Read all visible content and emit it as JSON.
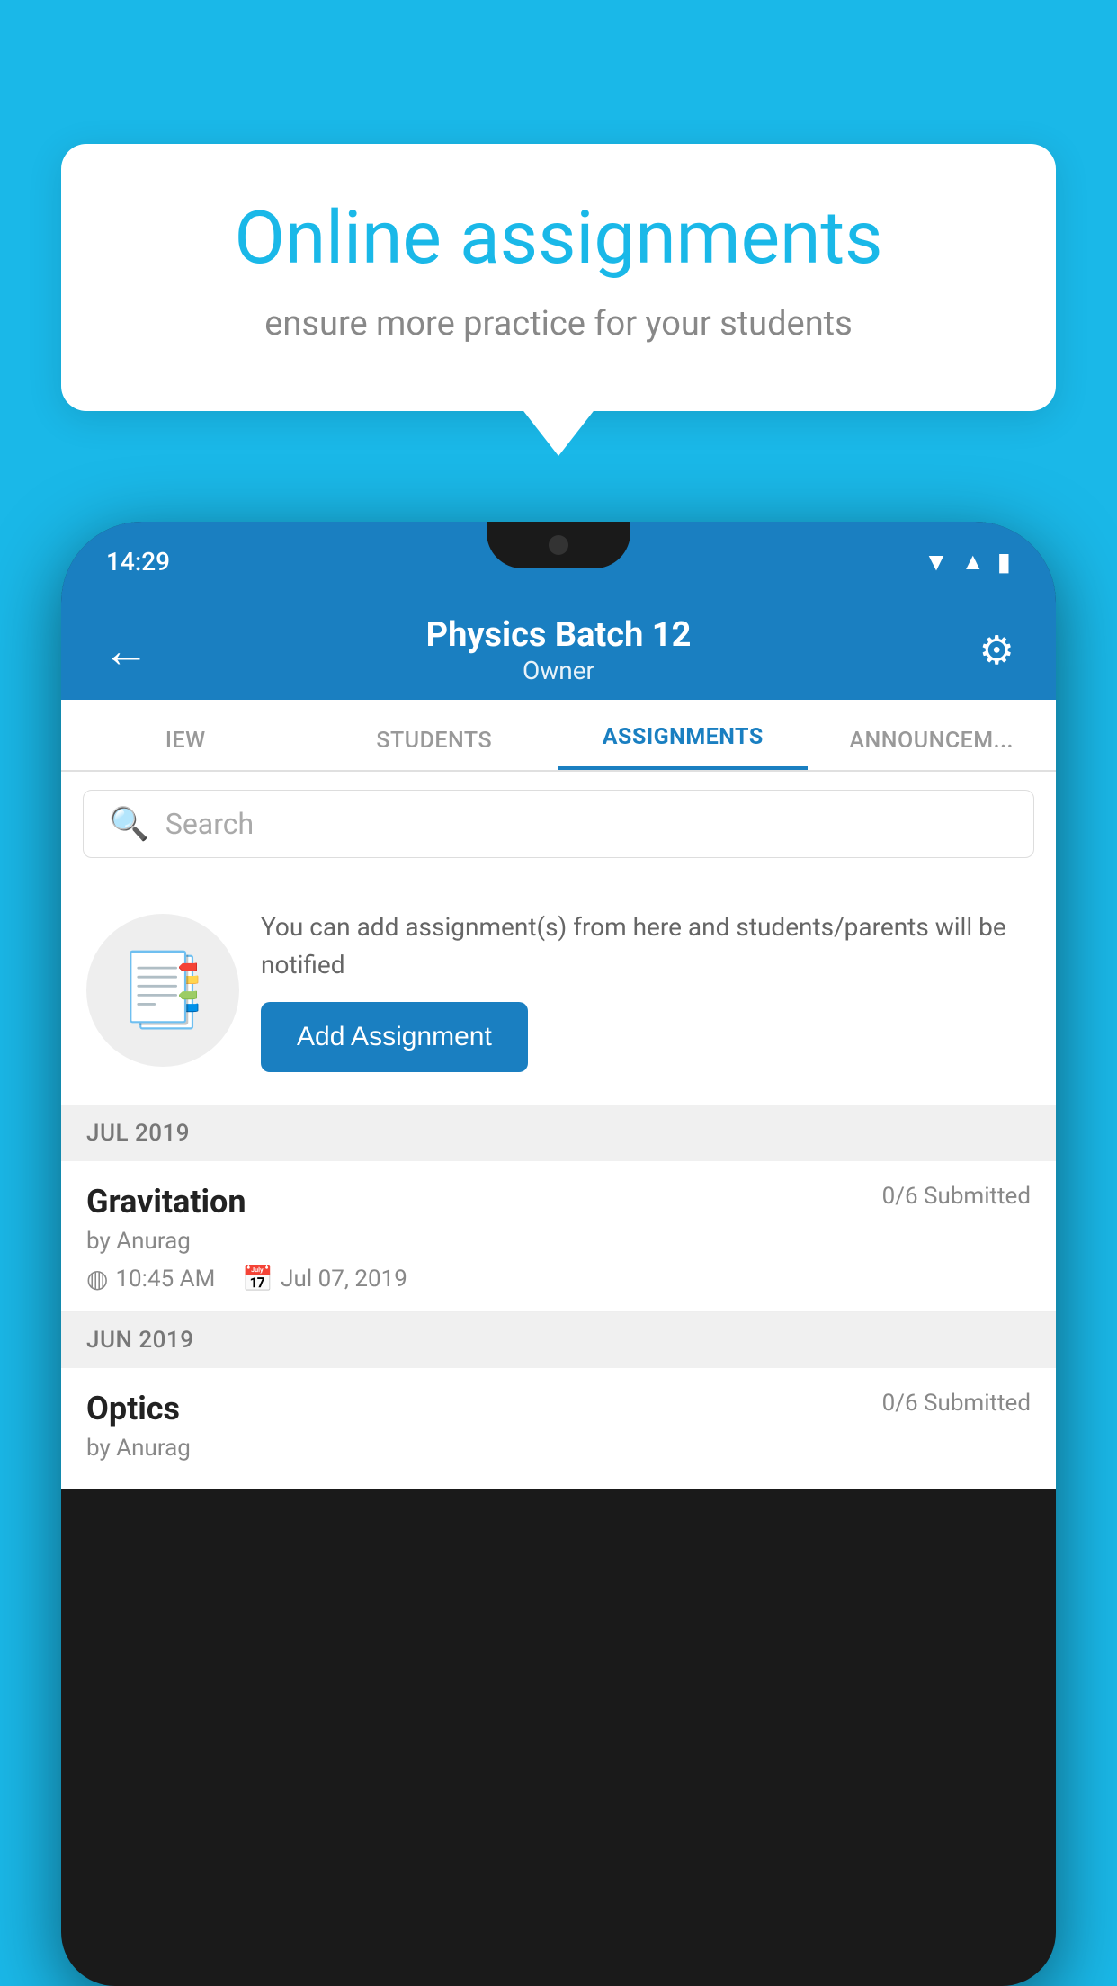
{
  "background_color": "#1ab8e8",
  "speech_card": {
    "title": "Online assignments",
    "subtitle": "ensure more practice for your students"
  },
  "status_bar": {
    "time": "14:29",
    "wifi_icon": "▾",
    "signal_icon": "▲",
    "battery_icon": "▮"
  },
  "app_bar": {
    "back_icon": "←",
    "title": "Physics Batch 12",
    "subtitle": "Owner",
    "settings_icon": "⚙"
  },
  "tabs": [
    {
      "label": "IEW",
      "active": false
    },
    {
      "label": "STUDENTS",
      "active": false
    },
    {
      "label": "ASSIGNMENTS",
      "active": true
    },
    {
      "label": "ANNOUNCEM...",
      "active": false
    }
  ],
  "search": {
    "placeholder": "Search"
  },
  "promo": {
    "description": "You can add assignment(s) from here and students/parents will be notified",
    "button_label": "Add Assignment"
  },
  "sections": [
    {
      "label": "JUL 2019",
      "assignments": [
        {
          "title": "Gravitation",
          "submitted": "0/6 Submitted",
          "by": "by Anurag",
          "time": "10:45 AM",
          "date": "Jul 07, 2019"
        }
      ]
    },
    {
      "label": "JUN 2019",
      "assignments": [
        {
          "title": "Optics",
          "submitted": "0/6 Submitted",
          "by": "by Anurag",
          "time": "",
          "date": ""
        }
      ]
    }
  ]
}
